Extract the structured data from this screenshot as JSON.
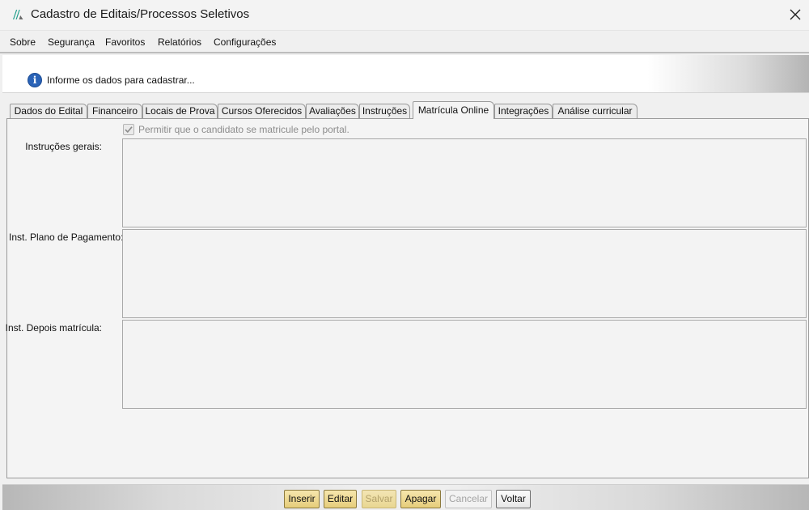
{
  "window": {
    "title": "Cadastro de Editais/Processos Seletivos",
    "icons": {
      "logo": "app-logo-icon",
      "close": "close-icon"
    }
  },
  "menu": {
    "items": [
      {
        "label": "Sobre"
      },
      {
        "label": "Segurança"
      },
      {
        "label": "Favoritos"
      },
      {
        "label": "Relatórios"
      },
      {
        "label": "Configurações"
      }
    ]
  },
  "info": {
    "icon": "info-icon",
    "icon_glyph": "i",
    "message": "Informe os dados para cadastrar..."
  },
  "tabs": [
    {
      "label": "Dados do Edital",
      "active": false
    },
    {
      "label": "Financeiro",
      "active": false
    },
    {
      "label": "Locais de Prova",
      "active": false
    },
    {
      "label": "Cursos Oferecidos",
      "active": false
    },
    {
      "label": "Avaliações",
      "active": false
    },
    {
      "label": "Instruções",
      "active": false
    },
    {
      "label": "Matrícula Online",
      "active": true
    },
    {
      "label": "Integrações",
      "active": false
    },
    {
      "label": "Análise curricular",
      "active": false
    }
  ],
  "form": {
    "allow_enroll": {
      "label": "Permitir que o candidato se matricule pelo portal.",
      "checked": true,
      "disabled": true
    },
    "general_instructions": {
      "label": "Instruções gerais:",
      "value": ""
    },
    "payment_plan_instructions": {
      "label": "Inst. Plano de Pagamento:",
      "value": ""
    },
    "after_enrollment_instructions": {
      "label": "Inst. Depois matrícula:",
      "value": ""
    }
  },
  "actions": {
    "insert": "Inserir",
    "edit": "Editar",
    "save": "Salvar",
    "delete": "Apagar",
    "cancel": "Cancelar",
    "back": "Voltar"
  },
  "colors": {
    "accent_logo": "#1f9e8a",
    "info_blue": "#2a63b7",
    "button_gold": "#e6cd7a"
  }
}
